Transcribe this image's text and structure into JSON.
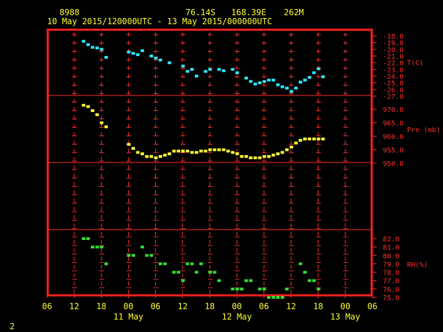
{
  "header": {
    "station_id": "8988",
    "lat": "76.14S",
    "lon": "168.39E",
    "elevation": "262M",
    "period": "10 May 2015/120000UTC - 13 May 2015/000000UTC"
  },
  "footer": {
    "page": "2"
  },
  "colors": {
    "frame": "#ff2020",
    "grid": "#ff3030",
    "axis_text": "#ffff33",
    "temperature": "#33e6ff",
    "pressure": "#ffff33",
    "rh": "#33dd33"
  },
  "chart_data": [
    {
      "type": "scatter",
      "ylabel": "T(C)",
      "ylim": [
        -27,
        -18
      ],
      "yticks": [
        "-18.0",
        "-19.0",
        "-20.0",
        "-21.0",
        "-22.0",
        "-23.0",
        "-24.0",
        "-25.0",
        "-26.0",
        "-27.0"
      ],
      "x_hours": [
        14,
        15,
        16,
        17,
        18,
        19,
        24,
        25,
        26,
        27,
        29,
        30,
        31,
        33,
        36,
        37,
        38,
        39,
        41,
        42,
        44,
        45,
        47,
        48,
        50,
        51,
        52,
        53,
        54,
        55,
        56,
        57,
        58,
        59,
        60,
        61,
        62,
        63,
        64,
        65,
        66,
        67
      ],
      "values": [
        -18.8,
        -19.3,
        -19.7,
        -19.8,
        -20.0,
        -21.2,
        -20.4,
        -20.6,
        -20.8,
        -20.2,
        -21.0,
        -21.3,
        -21.6,
        -22.0,
        -22.5,
        -23.3,
        -23.0,
        -24.0,
        -23.3,
        -23.0,
        -23.0,
        -23.2,
        -23.0,
        -23.5,
        -24.3,
        -24.8,
        -25.2,
        -25.0,
        -24.8,
        -24.6,
        -24.6,
        -25.3,
        -25.6,
        -25.8,
        -26.3,
        -25.8,
        -24.9,
        -24.6,
        -24.2,
        -23.5,
        -22.9,
        -24.1,
        -26.0
      ]
    },
    {
      "type": "scatter",
      "ylabel": "Pre (mb)",
      "ylim": [
        950,
        975
      ],
      "yticks": [
        "970.0",
        "965.0",
        "960.0",
        "955.0",
        "950.0"
      ],
      "x_hours": [
        14,
        15,
        16,
        17,
        18,
        19,
        24,
        25,
        26,
        27,
        28,
        29,
        30,
        31,
        32,
        33,
        34,
        35,
        36,
        37,
        38,
        39,
        40,
        41,
        42,
        43,
        44,
        45,
        46,
        47,
        48,
        49,
        50,
        51,
        52,
        53,
        54,
        55,
        56,
        57,
        58,
        59,
        60,
        61,
        62,
        63,
        64,
        65,
        66,
        67
      ],
      "values": [
        971.5,
        971.0,
        969.5,
        968.0,
        965.0,
        963.5,
        957.0,
        955.5,
        954.0,
        953.5,
        952.5,
        952.5,
        952.0,
        952.5,
        953.0,
        953.5,
        954.5,
        954.5,
        954.5,
        954.5,
        954.0,
        954.0,
        954.5,
        954.5,
        955.0,
        955.0,
        955.0,
        955.0,
        954.5,
        954.0,
        953.5,
        952.5,
        952.5,
        952.0,
        952.0,
        952.0,
        952.5,
        952.5,
        953.0,
        953.5,
        954.0,
        955.0,
        956.0,
        957.5,
        958.5,
        959.0,
        959.0,
        959.0,
        959.0,
        959.0
      ]
    },
    {
      "type": "scatter",
      "ylabel": "RH(%)",
      "ylim": [
        75,
        83
      ],
      "yticks": [
        "82.0",
        "81.0",
        "80.0",
        "79.0",
        "78.0",
        "77.0",
        "76.0",
        "75.0"
      ],
      "x_hours": [
        14,
        15,
        16,
        17,
        18,
        19,
        24,
        25,
        27,
        28,
        29,
        31,
        32,
        34,
        35,
        36,
        37,
        38,
        39,
        40,
        42,
        43,
        44,
        47,
        48,
        49,
        50,
        51,
        53,
        54,
        55,
        56,
        57,
        58,
        59,
        62,
        63,
        64,
        65,
        66
      ],
      "values": [
        82,
        82,
        81,
        81,
        81,
        79,
        80,
        80,
        81,
        80,
        80,
        79,
        79,
        78,
        78,
        77,
        79,
        79,
        78,
        79,
        78,
        78,
        77,
        76,
        76,
        76,
        77,
        77,
        76,
        76,
        75,
        75,
        75,
        75,
        76,
        79,
        78,
        77,
        77,
        76
      ]
    }
  ],
  "x_axis": {
    "range_hours": [
      6,
      78
    ],
    "tick_labels": [
      "06",
      "12",
      "18",
      "00",
      "06",
      "12",
      "18",
      "00",
      "06",
      "12",
      "18",
      "00",
      "06"
    ],
    "day_labels": [
      {
        "label": "11 May",
        "at_hour": 24
      },
      {
        "label": "12 May",
        "at_hour": 48
      },
      {
        "label": "13 May",
        "at_hour": 72
      }
    ]
  }
}
